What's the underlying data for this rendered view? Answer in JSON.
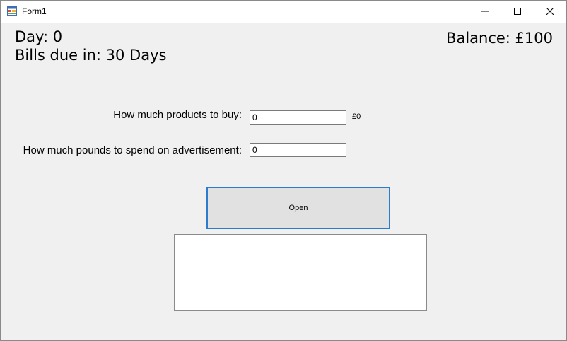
{
  "window": {
    "title": "Form1",
    "title_icon": "winforms-app-icon"
  },
  "controls": {
    "minimize_icon": "minimize-icon",
    "maximize_icon": "maximize-icon",
    "close_icon": "close-icon"
  },
  "status": {
    "day": "Day: 0",
    "bills_due": "Bills due in: 30 Days",
    "balance": "Balance: £100"
  },
  "form": {
    "products_label": "How much products to buy:",
    "products_value": "0",
    "products_cost": "£0",
    "advert_label": "How much pounds to spend on advertisement:",
    "advert_value": "0",
    "open_label": "Open"
  },
  "colors": {
    "focus_border": "#2b7ccf",
    "window_bg": "#f0f0f0",
    "button_bg": "#e1e1e1"
  }
}
